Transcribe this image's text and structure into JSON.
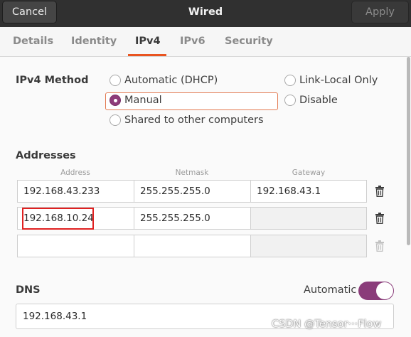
{
  "header": {
    "cancel_label": "Cancel",
    "title": "Wired",
    "apply_label": "Apply"
  },
  "tabs": [
    {
      "label": "Details"
    },
    {
      "label": "Identity"
    },
    {
      "label": "IPv4",
      "active": true
    },
    {
      "label": "IPv6"
    },
    {
      "label": "Security"
    }
  ],
  "ipv4_method": {
    "label": "IPv4 Method",
    "options": [
      {
        "label": "Automatic (DHCP)",
        "checked": false
      },
      {
        "label": "Manual",
        "checked": true
      },
      {
        "label": "Shared to other computers",
        "checked": false
      },
      {
        "label": "Link-Local Only",
        "checked": false
      },
      {
        "label": "Disable",
        "checked": false
      }
    ]
  },
  "addresses": {
    "label": "Addresses",
    "columns": [
      "Address",
      "Netmask",
      "Gateway"
    ],
    "rows": [
      {
        "address": "192.168.43.233",
        "netmask": "255.255.255.0",
        "gateway": "192.168.43.1"
      },
      {
        "address": "192.168.10.24",
        "netmask": "255.255.255.0",
        "gateway": ""
      },
      {
        "address": "",
        "netmask": "",
        "gateway": ""
      }
    ]
  },
  "dns": {
    "label": "DNS",
    "automatic_label": "Automatic",
    "automatic_on": true,
    "value": "192.168.43.1"
  },
  "watermark": "CSDN @Tensor···Flow",
  "colors": {
    "accent_orange": "#e95420",
    "toggle_purple": "#8a3c7a",
    "highlight_red": "#e02020",
    "titlebar": "#303030"
  }
}
